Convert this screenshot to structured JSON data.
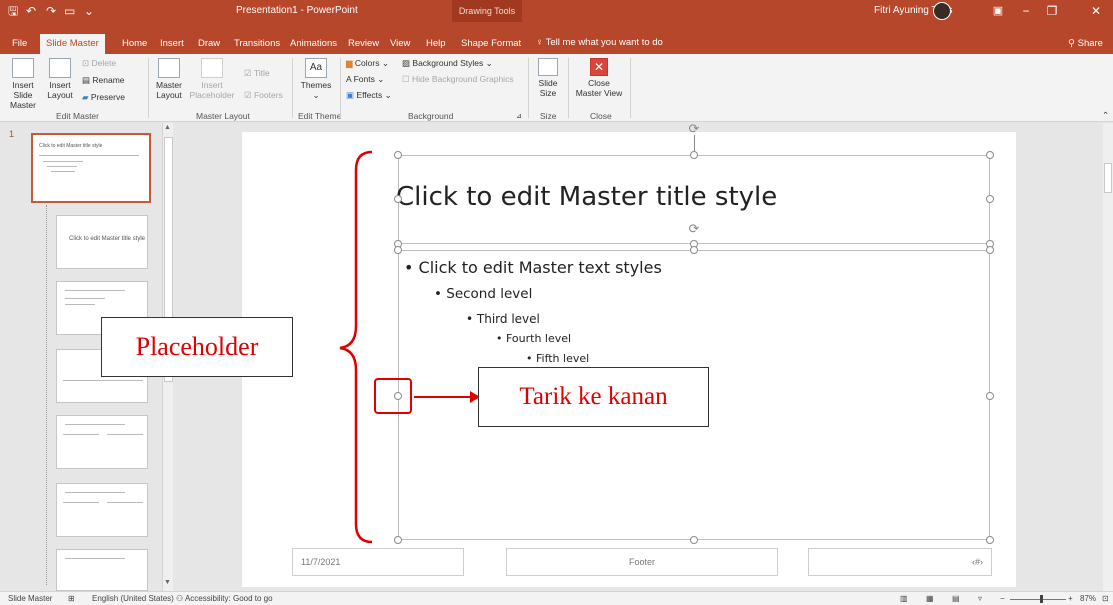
{
  "titlebar": {
    "title": "Presentation1  -  PowerPoint",
    "contextual": "Drawing Tools",
    "user": "Fitri Ayuning Tyas",
    "minimize": "−",
    "restore": "❐",
    "close": "✕"
  },
  "tabs": {
    "items": [
      "File",
      "Slide Master",
      "Home",
      "Insert",
      "Draw",
      "Transitions",
      "Animations",
      "Review",
      "View",
      "Help",
      "Shape Format"
    ],
    "search": "Tell me what you want to do",
    "share": "Share"
  },
  "ribbon": {
    "insert_slide_master": [
      "Insert Slide",
      "Master"
    ],
    "insert_layout": [
      "Insert",
      "Layout"
    ],
    "delete": "Delete",
    "rename": "Rename",
    "preserve": "Preserve",
    "master_layout": [
      "Master",
      "Layout"
    ],
    "insert_placeholder": [
      "Insert",
      "Placeholder"
    ],
    "title_check": "Title",
    "footers_check": "Footers",
    "themes": "Themes",
    "colors": "Colors",
    "fonts": "Fonts",
    "effects": "Effects",
    "background_styles": "Background Styles",
    "hide_bg": "Hide Background Graphics",
    "slide_size": [
      "Slide",
      "Size"
    ],
    "close_master": [
      "Close",
      "Master View"
    ],
    "groups": {
      "edit_master": "Edit Master",
      "master_layout": "Master Layout",
      "edit_theme": "Edit Theme",
      "background": "Background",
      "size": "Size",
      "close": "Close"
    }
  },
  "thumbs": {
    "slide_number": "1",
    "master_title": "Click to edit Master title style",
    "layout_title": "Click to edit Master title style"
  },
  "slide": {
    "title": "Click to edit Master title style",
    "level1": "• Click to edit Master text styles",
    "level2": "• Second level",
    "level3": "• Third level",
    "level4": "• Fourth level",
    "level5": "• Fifth level",
    "date": "11/7/2021",
    "footer": "Footer",
    "page": "‹#›"
  },
  "annotations": {
    "placeholder": "Placeholder",
    "drag_right": "Tarik ke kanan",
    "color": "#e00000"
  },
  "status": {
    "mode": "Slide Master",
    "language": "English (United States)",
    "accessibility": "Accessibility: Good to go",
    "zoom": "87%"
  }
}
